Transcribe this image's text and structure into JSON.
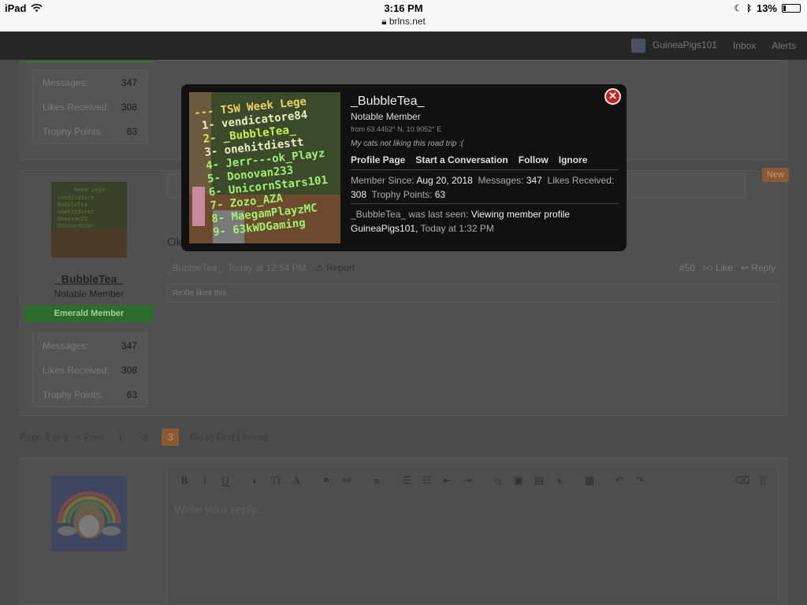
{
  "statusbar": {
    "device": "iPad",
    "time": "3:16 PM",
    "url": "brlns.net",
    "battery": "13%"
  },
  "nav": {
    "username": "GuineaPigs101",
    "inbox": "Inbox",
    "alerts": "Alerts"
  },
  "posts": [
    {
      "stats": [
        {
          "label": "Messages:",
          "value": "347"
        },
        {
          "label": "Likes Received:",
          "value": "308"
        },
        {
          "label": "Trophy Points:",
          "value": "63"
        }
      ]
    },
    {
      "username": "_BubbleTea_",
      "usertitle": "Notable Member",
      "banner": "Emerald Member",
      "stats": [
        {
          "label": "Messages:",
          "value": "347"
        },
        {
          "label": "Likes Received:",
          "value": "308"
        },
        {
          "label": "Trophy Points:",
          "value": "63"
        }
      ],
      "message_start": "Ok",
      "meta": "_BubbleTea_, Today at 12:54 PM",
      "report": "Report",
      "post_number": "#50",
      "like": "Like",
      "reply": "Reply",
      "likes_text": "ReXie likes this.",
      "new_badge": "New"
    }
  ],
  "pagination": {
    "label": "Page 3 of 3",
    "prev": "< Prev",
    "pages": [
      "1",
      "2",
      "3"
    ],
    "current": "3",
    "first_unread": "Go to First Unread"
  },
  "editor": {
    "placeholder": "Write your reply..."
  },
  "popup": {
    "name": "_BubbleTea_",
    "title": "Notable Member",
    "location": "from 63.4452° N, 10.9052° E",
    "status": "My cats not liking this road trip :(",
    "links": [
      "Profile Page",
      "Start a Conversation",
      "Follow",
      "Ignore"
    ],
    "member_since_label": "Member Since:",
    "member_since": "Aug 20, 2018",
    "messages_label": "Messages:",
    "messages": "347",
    "likes_label": "Likes Received:",
    "likes": "308",
    "trophy_label": "Trophy Points:",
    "trophy": "63",
    "last_seen_prefix": "_BubbleTea_ was last seen:",
    "last_seen_activity": "Viewing member profile GuineaPigs101,",
    "last_seen_time": "Today at 1:32 PM",
    "avatar_lines": [
      "--- TSW Week Lege",
      "1- vendicatore84",
      "2- _BubbleTea_",
      "3- onehitdiestt",
      "4- Jerr---ok_Playz",
      "5- Donovan233",
      "6- UnicornStars101",
      "7- Zozo_AZA",
      "8- MaegamPlayzMC",
      "9- 63kWDGaming"
    ]
  },
  "colors": {
    "popup_bg": "#111111",
    "close": "#c92424",
    "emerald": "#2c6b2c",
    "active_page": "#8a5a33"
  }
}
